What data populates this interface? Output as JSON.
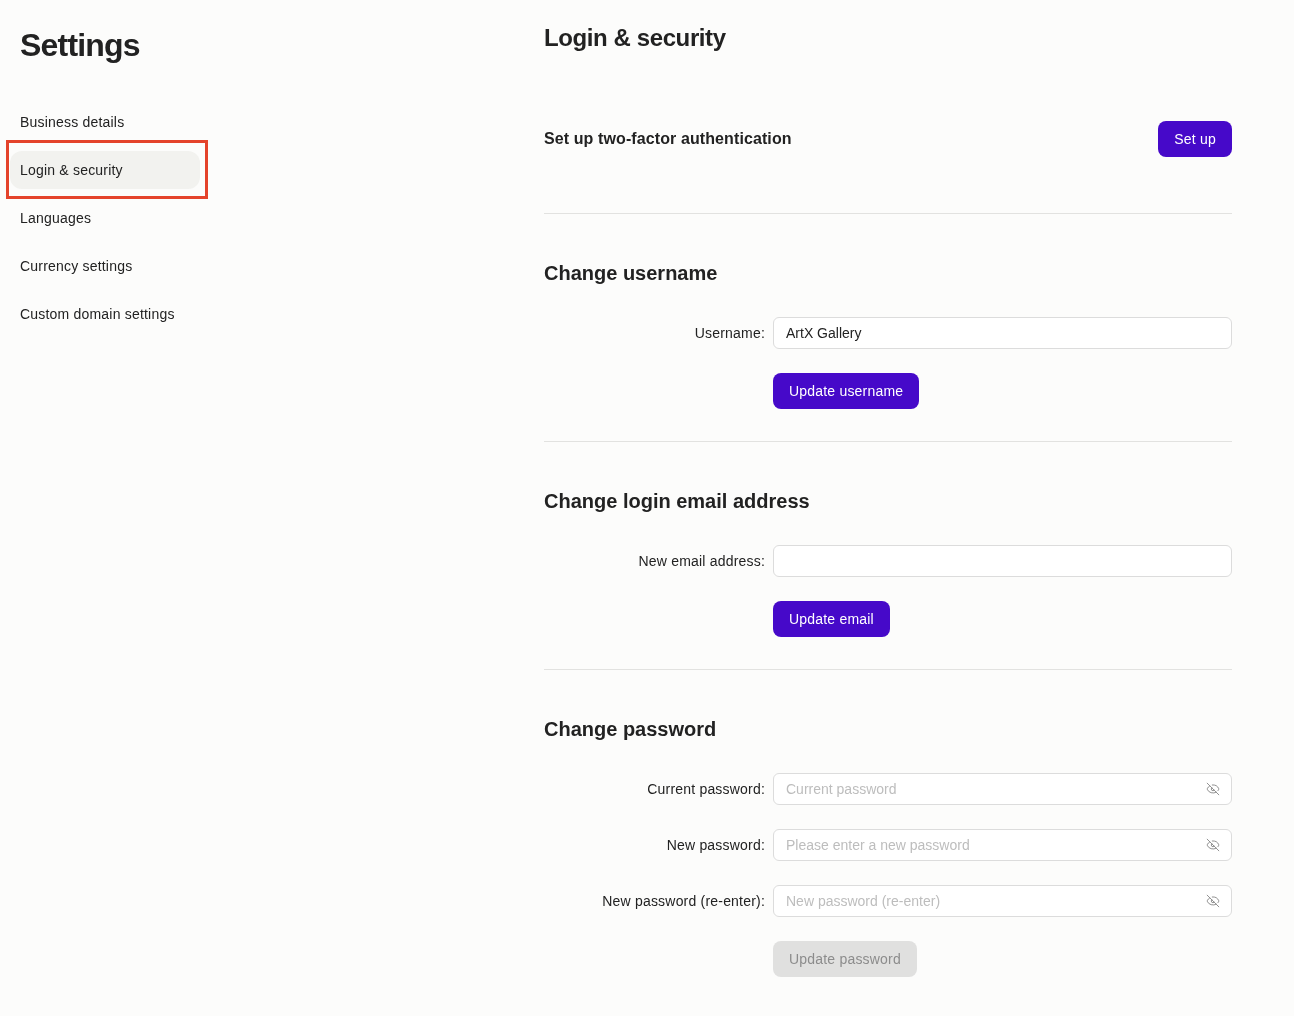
{
  "sidebar": {
    "title": "Settings",
    "items": [
      {
        "label": "Business details",
        "selected": false,
        "highlighted": false
      },
      {
        "label": "Login & security",
        "selected": true,
        "highlighted": true
      },
      {
        "label": "Languages",
        "selected": false,
        "highlighted": false
      },
      {
        "label": "Currency settings",
        "selected": false,
        "highlighted": false
      },
      {
        "label": "Custom domain settings",
        "selected": false,
        "highlighted": false
      }
    ]
  },
  "main": {
    "title": "Login & security",
    "two_factor": {
      "label": "Set up two-factor authentication",
      "button": {
        "label": "Set up",
        "disabled": false
      }
    },
    "sections": [
      {
        "heading": "Change username",
        "fields": [
          {
            "kind": "text",
            "label": "Username:",
            "value": "ArtX Gallery"
          }
        ],
        "button": {
          "label": "Update username",
          "disabled": false
        }
      },
      {
        "heading": "Change login email address",
        "fields": [
          {
            "kind": "text",
            "label": "New email address:"
          }
        ],
        "button": {
          "label": "Update email",
          "disabled": false
        }
      },
      {
        "heading": "Change password",
        "fields": [
          {
            "kind": "password",
            "label": "Current password:",
            "placeholder": "Current password"
          },
          {
            "kind": "password",
            "label": "New password:",
            "placeholder": "Please enter a new password"
          },
          {
            "kind": "password",
            "label": "New password (re-enter):",
            "placeholder": "New password (re-enter)"
          }
        ],
        "button": {
          "label": "Update password",
          "disabled": true
        }
      }
    ]
  }
}
